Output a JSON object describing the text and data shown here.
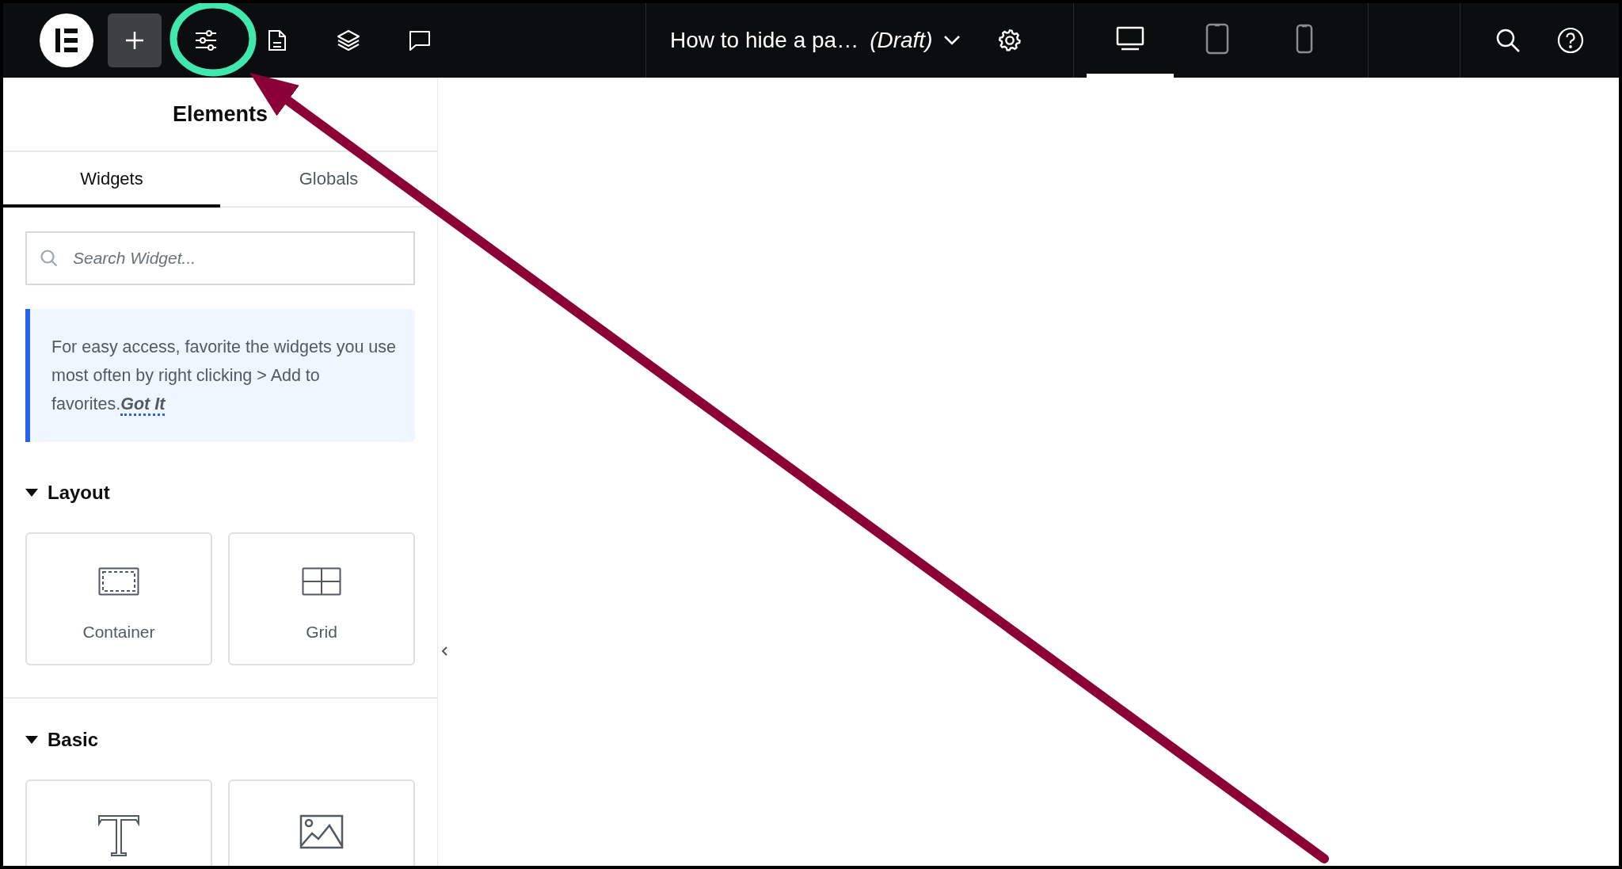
{
  "topbar": {
    "tools": [
      {
        "kind": "add",
        "active": true
      },
      {
        "kind": "sliders",
        "active": false
      },
      {
        "kind": "page",
        "active": false
      },
      {
        "kind": "layers",
        "active": false
      },
      {
        "kind": "comment",
        "active": false
      }
    ],
    "document": {
      "title": "How to hide a pa…",
      "status": "(Draft)"
    },
    "devices": [
      {
        "kind": "desktop",
        "selected": true
      },
      {
        "kind": "tablet",
        "selected": false
      },
      {
        "kind": "mobile",
        "selected": false
      }
    ]
  },
  "sidebar": {
    "title": "Elements",
    "tabs": [
      {
        "label": "Widgets",
        "selected": true
      },
      {
        "label": "Globals",
        "selected": false
      }
    ],
    "search": {
      "placeholder": "Search Widget..."
    },
    "notice": {
      "text": "For easy access, favorite the widgets you use most often by right clicking > Add to favorites.",
      "link": "Got It"
    },
    "sections": [
      {
        "title": "Layout",
        "expanded": true,
        "widgets": [
          {
            "kind": "container",
            "label": "Container"
          },
          {
            "kind": "grid",
            "label": "Grid"
          }
        ]
      },
      {
        "title": "Basic",
        "expanded": true,
        "widgets": [
          {
            "kind": "heading"
          },
          {
            "kind": "image"
          }
        ]
      }
    ]
  }
}
